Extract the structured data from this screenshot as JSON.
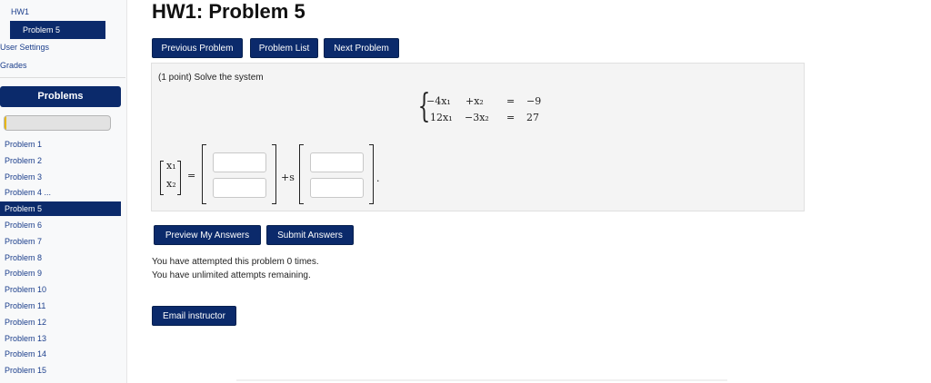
{
  "sidebar": {
    "breadcrumb_course": "HW1",
    "breadcrumb_current": "Problem 5",
    "user_settings": "User Settings",
    "grades": "Grades",
    "problems_header": "Problems",
    "progress_fraction": 0.02,
    "progress_color": "#e8b70e",
    "problems": [
      {
        "label": "Problem 1",
        "active": false
      },
      {
        "label": "Problem 2",
        "active": false
      },
      {
        "label": "Problem 3",
        "active": false
      },
      {
        "label": "Problem 4 ...",
        "active": false
      },
      {
        "label": "Problem 5",
        "active": true
      },
      {
        "label": "Problem 6",
        "active": false
      },
      {
        "label": "Problem 7",
        "active": false
      },
      {
        "label": "Problem 8",
        "active": false
      },
      {
        "label": "Problem 9",
        "active": false
      },
      {
        "label": "Problem 10",
        "active": false
      },
      {
        "label": "Problem 11",
        "active": false
      },
      {
        "label": "Problem 12",
        "active": false
      },
      {
        "label": "Problem 13",
        "active": false
      },
      {
        "label": "Problem 14",
        "active": false
      },
      {
        "label": "Problem 15",
        "active": false
      }
    ]
  },
  "main": {
    "title": "HW1: Problem 5",
    "nav": {
      "previous": "Previous Problem",
      "list": "Problem List",
      "next": "Next Problem"
    },
    "problem": {
      "prompt": "(1 point) Solve the system",
      "system": {
        "row1": {
          "a": "−4x₁",
          "b": "+x₂",
          "eq": "=",
          "rhs": "−9"
        },
        "row2": {
          "a": "12x₁",
          "b": "−3x₂",
          "eq": "=",
          "rhs": "27"
        }
      },
      "vector": {
        "x1": "x₁",
        "x2": "x₂",
        "eq": "=",
        "plus_s": "+s",
        "period": "."
      },
      "answers": {
        "c1": "",
        "c2": "",
        "d1": "",
        "d2": ""
      }
    },
    "actions": {
      "preview": "Preview My Answers",
      "submit": "Submit Answers"
    },
    "status": {
      "attempted": "You have attempted this problem 0 times.",
      "remaining": "You have unlimited attempts remaining."
    },
    "email": "Email instructor"
  },
  "colors": {
    "primary": "#0b2a6b",
    "link": "#1c3f8c"
  }
}
